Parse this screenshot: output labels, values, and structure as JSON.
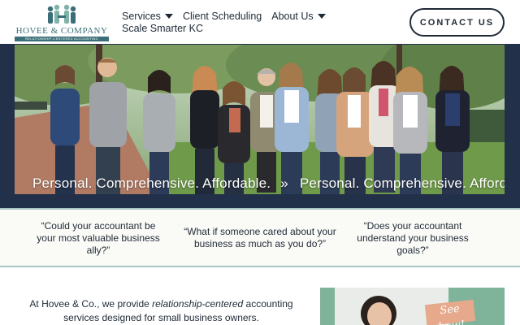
{
  "brand": {
    "name": "HOVEE & COMPANY",
    "tagline": "RELATIONSHIP-CENTERED ACCOUNTING",
    "color_primary": "#3a6f78",
    "color_navy": "#223149"
  },
  "nav": {
    "items": [
      {
        "label": "Services",
        "has_dropdown": true
      },
      {
        "label": "Client Scheduling",
        "has_dropdown": false
      },
      {
        "label": "About Us",
        "has_dropdown": true
      },
      {
        "label": "Scale Smarter KC",
        "has_dropdown": false
      }
    ]
  },
  "header": {
    "contact_label": "CONTACT US"
  },
  "hero": {
    "marquee_text": "Personal. Comprehensive. Affordable.",
    "marquee_separator": "»",
    "marquee_partial": "Personal. Comprehensive. Afforda"
  },
  "quotes": [
    "“Could your accountant be your most valuable business ally?”",
    "“What if someone cared about your business as much as you do?”",
    "“Does your accountant understand your business goals?”"
  ],
  "intro": {
    "prefix": "At Hovee & Co., we provide ",
    "emphasis": "relationship-centered",
    "suffix": " accounting services designed for small business owners."
  },
  "video": {
    "overlay_label": "See how!"
  }
}
